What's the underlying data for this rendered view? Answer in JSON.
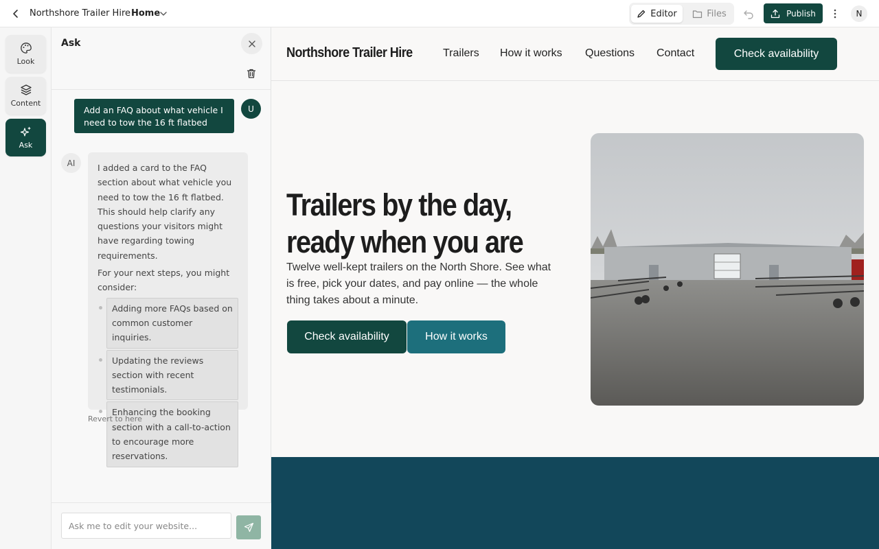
{
  "topbar": {
    "site_name": "Northshore Trailer Hire",
    "page": "Home",
    "editor_label": "Editor",
    "files_label": "Files",
    "publish_label": "Publish",
    "avatar_initial": "N"
  },
  "rail": {
    "items": [
      {
        "label": "Look",
        "icon": "palette-icon"
      },
      {
        "label": "Content",
        "icon": "layers-icon"
      },
      {
        "label": "Ask",
        "icon": "sparkles-icon",
        "active": true
      }
    ]
  },
  "chat": {
    "title": "Ask",
    "user_initial": "U",
    "user_message": "Add an FAQ about what vehicle I need to tow the 16 ft flatbed",
    "ai_initial": "AI",
    "ai_paragraph": "I added a card to the FAQ section about what vehicle you need to tow the 16 ft flatbed. This should help clarify any questions your visitors might have regarding towing requirements.",
    "ai_next_steps_intro": "For your next steps, you might consider:",
    "ai_suggestions": [
      "Adding more FAQs based on common customer inquiries.",
      "Updating the reviews section with recent testimonials.",
      "Enhancing the booking section with a call-to-action to encourage more reservations."
    ],
    "revert_label": "Revert to here",
    "input_placeholder": "Ask me to edit your website..."
  },
  "site": {
    "brand": "Northshore Trailer Hire",
    "nav": [
      "Trailers",
      "How it works",
      "Questions",
      "Contact"
    ],
    "nav_cta": "Check availability",
    "hero_heading_line1": "Trailers by the day,",
    "hero_heading_line2": "ready when you are",
    "hero_text": "Twelve well-kept trailers on the North Shore. See what is free, pick your dates, and pay online — the whole thing takes about a minute.",
    "primary_cta": "Check availability",
    "secondary_cta": "How it works"
  },
  "colors": {
    "brand_green": "#12473f",
    "teal_button": "#1d6f7c",
    "footer_band": "#12475a",
    "send_button": "#8fb5a4"
  }
}
